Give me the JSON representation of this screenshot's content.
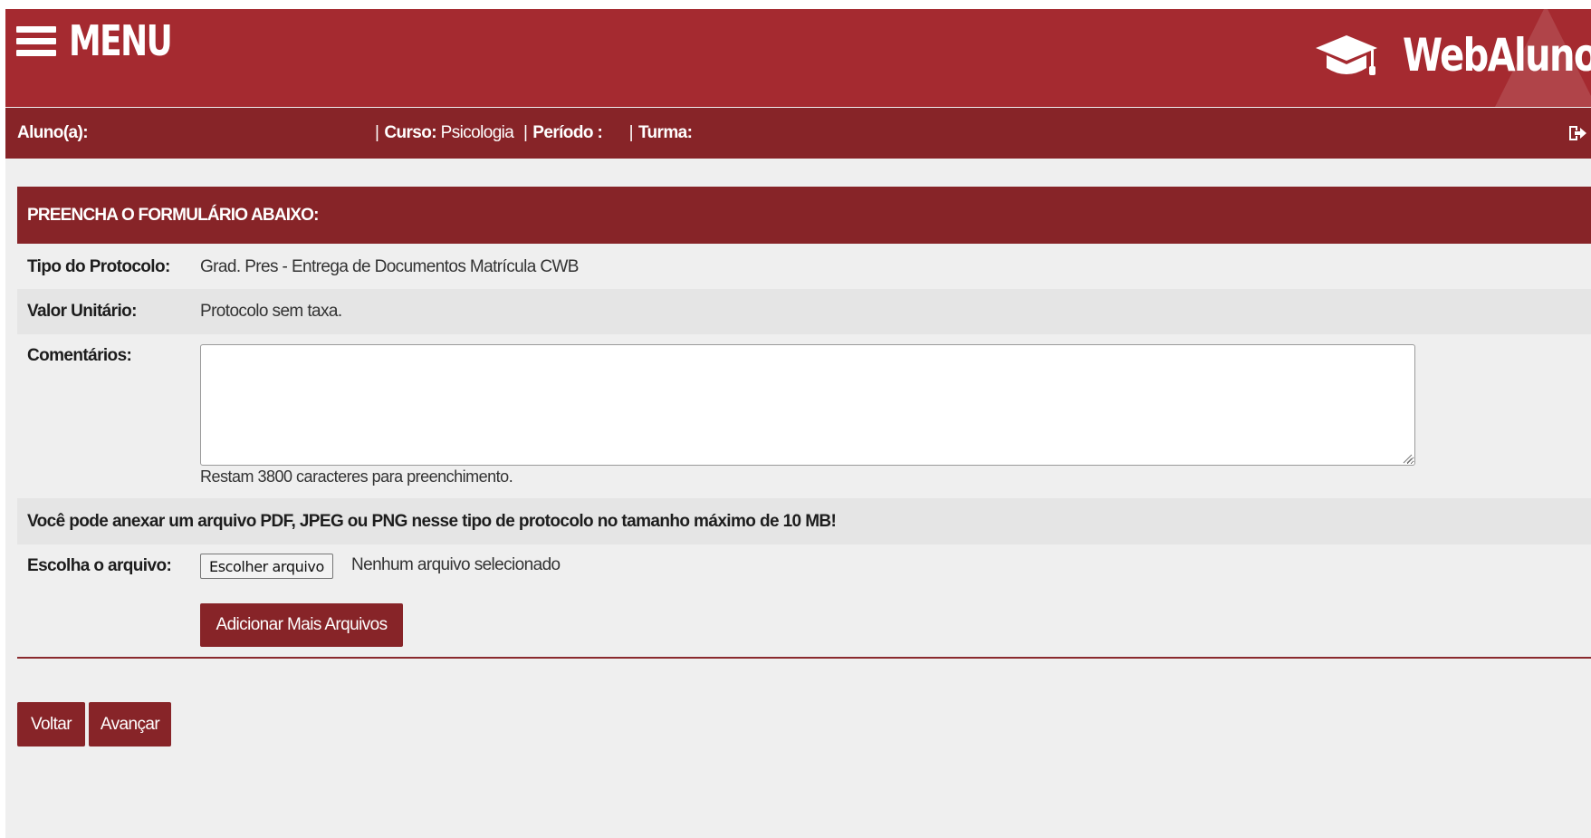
{
  "header": {
    "menu_label": "MENU",
    "brand_title": "WebAluno"
  },
  "info_bar": {
    "student_label": "Aluno(a):",
    "course_label": "Curso:",
    "course_value": "Psicologia",
    "period_label": "Período :",
    "class_label": "Turma:",
    "separator": "|"
  },
  "form": {
    "title": "PREENCHA O FORMULÁRIO ABAIXO:",
    "protocol_type_label": "Tipo do Protocolo:",
    "protocol_type_value": "Grad. Pres - Entrega de Documentos Matrícula CWB",
    "unit_value_label": "Valor Unitário:",
    "unit_value_value": "Protocolo sem taxa.",
    "comments_label": "Comentários:",
    "comments_value": "",
    "char_counter": "Restam 3800 caracteres para preenchimento.",
    "attach_note": "Você pode anexar um arquivo PDF, JPEG ou PNG nesse tipo de protocolo no tamanho máximo de 10 MB!",
    "file_label": "Escolha o arquivo:",
    "file_button_label": "Escolher arquivo",
    "file_status": "Nenhum arquivo selecionado",
    "add_files_label": "Adicionar Mais Arquivos"
  },
  "actions": {
    "back_label": "Voltar",
    "next_label": "Avançar"
  },
  "colors": {
    "header_red": "#a52a30",
    "dark_red": "#872428",
    "page_bg": "#efefef",
    "row_shade": "#e5e5e5"
  },
  "icons": {
    "menu": "hamburger-icon",
    "brand": "graduation-cap-icon",
    "logout": "logout-icon"
  }
}
